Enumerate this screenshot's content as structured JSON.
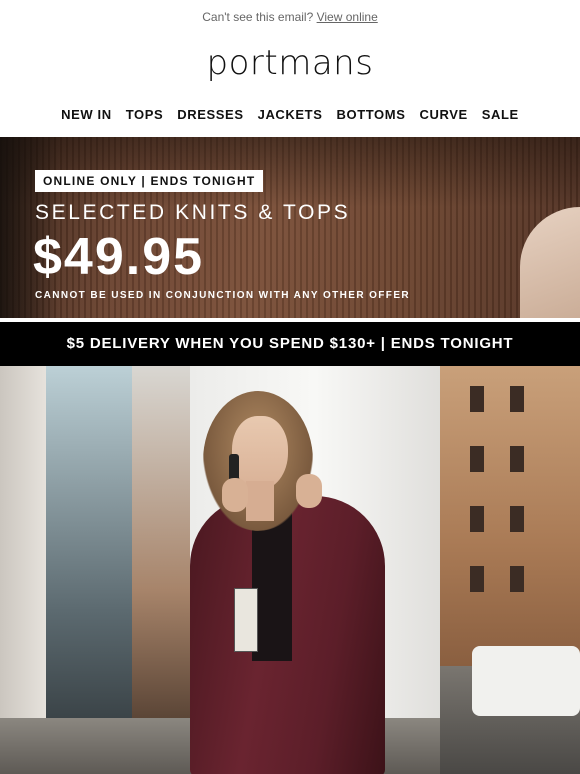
{
  "topbar": {
    "text": "Can't see this email?",
    "link": "View online"
  },
  "brand": {
    "logo": "portmans"
  },
  "nav": {
    "items": [
      "NEW IN",
      "TOPS",
      "DRESSES",
      "JACKETS",
      "BOTTOMS",
      "CURVE",
      "SALE"
    ]
  },
  "hero": {
    "badge": "ONLINE ONLY | ENDS TONIGHT",
    "title": "SELECTED KNITS & TOPS",
    "price": "$49.95",
    "fineprint": "CANNOT BE USED IN CONJUNCTION WITH ANY OTHER OFFER"
  },
  "banner": {
    "text": "$5 DELIVERY WHEN YOU SPEND $130+ | ENDS TONIGHT"
  },
  "colors": {
    "banner_bg": "#000000",
    "knit_brown": "#6b4330",
    "jacket_burgundy": "#5c1e29"
  }
}
